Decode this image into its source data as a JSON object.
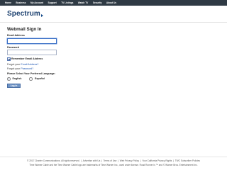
{
  "nav": {
    "items": [
      {
        "label": "Home"
      },
      {
        "label": "Business"
      },
      {
        "label": "My Account"
      },
      {
        "label": "Support"
      },
      {
        "label": "TV Listings"
      },
      {
        "label": "Watch TV"
      },
      {
        "label": "Security"
      },
      {
        "label": "About Us"
      }
    ]
  },
  "brand": {
    "logo_text": "Spectrum",
    "color": "#1a3f6e"
  },
  "form": {
    "title": "Webmail Sign In",
    "email_label": "Email Address",
    "email_value": "",
    "password_label": "Password",
    "password_value": "",
    "remember_label": "Remember Email Address",
    "remember_checked": true,
    "forgot_email_prefix": "Forgot your",
    "forgot_email_link": "Email Address?",
    "forgot_password_prefix": "Forgot your",
    "forgot_password_link": "Password?",
    "language_title": "Please Select Your Preferred Language:",
    "language_options": [
      {
        "label": "English",
        "checked": true
      },
      {
        "label": "Español",
        "checked": false
      }
    ],
    "login_button": "Log In"
  },
  "footer": {
    "copyright": "© 2017 Charter Communications. All rights reserved.",
    "links": [
      {
        "label": "Advertise with Us"
      },
      {
        "label": "Terms of Use"
      },
      {
        "label": "Web Privacy Policy"
      },
      {
        "label": "Your California Privacy Rights"
      },
      {
        "label": "TWC Subscriber Policies"
      }
    ],
    "trademark": "Time Warner Cable and the Time Warner Cable logo are trademarks of Time Warner Inc., used under license. Road Runner is ™ and © Warner Bros. Entertainment Inc."
  }
}
